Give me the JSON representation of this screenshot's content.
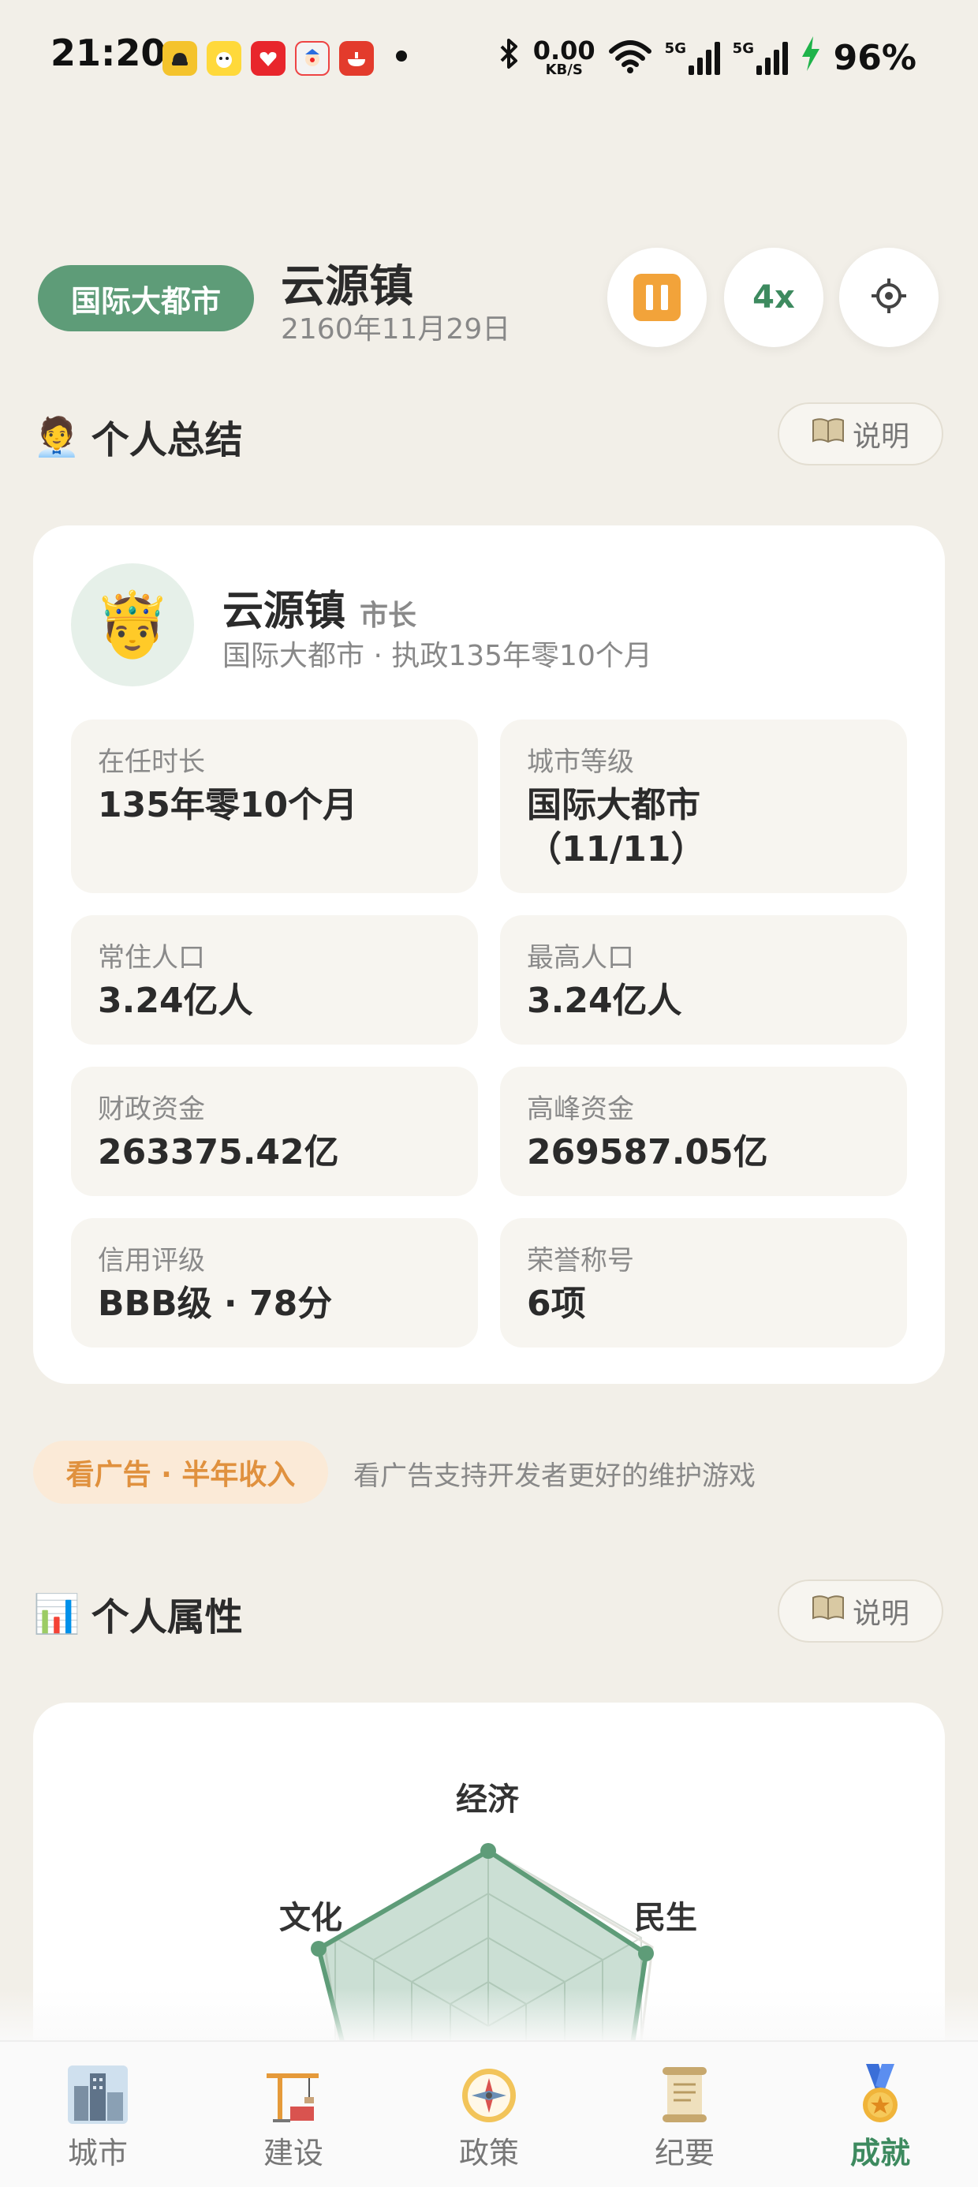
{
  "status_bar": {
    "time": "21:20",
    "net_speed_value": "0.00",
    "net_speed_unit": "KB/S",
    "signal1_label": "5G",
    "signal2_label": "5G",
    "battery": "96%",
    "notification_icons": [
      "car-app-icon",
      "puppy-app-icon",
      "heart-app-icon",
      "clown-app-icon",
      "hotpot-app-icon"
    ]
  },
  "header": {
    "level": "国际大都市",
    "town": "云源镇",
    "date": "2160年11月29日",
    "speed": "4x",
    "pause_color": "#f2a33a"
  },
  "summary": {
    "title_emoji": "🧑‍💼",
    "title": "个人总结",
    "explain_label": "说明",
    "avatar_emoji": "🤴",
    "mayor_name": "云源镇",
    "mayor_role": "市长",
    "mayor_sub": "国际大都市 · 执政135年零10个月",
    "stats": [
      {
        "label": "在任时长",
        "value": "135年零10个月"
      },
      {
        "label": "城市等级",
        "value": "国际大都市（11/11）"
      },
      {
        "label": "常住人口",
        "value": "3.24亿人"
      },
      {
        "label": "最高人口",
        "value": "3.24亿人"
      },
      {
        "label": "财政资金",
        "value": "263375.42亿"
      },
      {
        "label": "高峰资金",
        "value": "269587.05亿"
      },
      {
        "label": "信用评级",
        "value": "BBB级 · 78分"
      },
      {
        "label": "荣誉称号",
        "value": "6项"
      }
    ]
  },
  "ad": {
    "button": "看广告 · 半年收入",
    "text": "看广告支持开发者更好的维护游戏"
  },
  "attributes": {
    "title_emoji": "📊",
    "title": "个人属性",
    "explain_label": "说明",
    "radar_labels": {
      "top": "经济",
      "left": "文化",
      "right": "民生"
    }
  },
  "nav": {
    "items": [
      {
        "label": "城市",
        "icon": "city-icon"
      },
      {
        "label": "建设",
        "icon": "construction-icon"
      },
      {
        "label": "政策",
        "icon": "compass-icon"
      },
      {
        "label": "纪要",
        "icon": "scroll-icon"
      },
      {
        "label": "成就",
        "icon": "medal-icon"
      }
    ],
    "active": "成就",
    "active_color": "#3d8a5f"
  },
  "colors": {
    "background": "#f2efe8",
    "accent_green": "#5e9c78",
    "ad_orange": "#e0913e"
  }
}
